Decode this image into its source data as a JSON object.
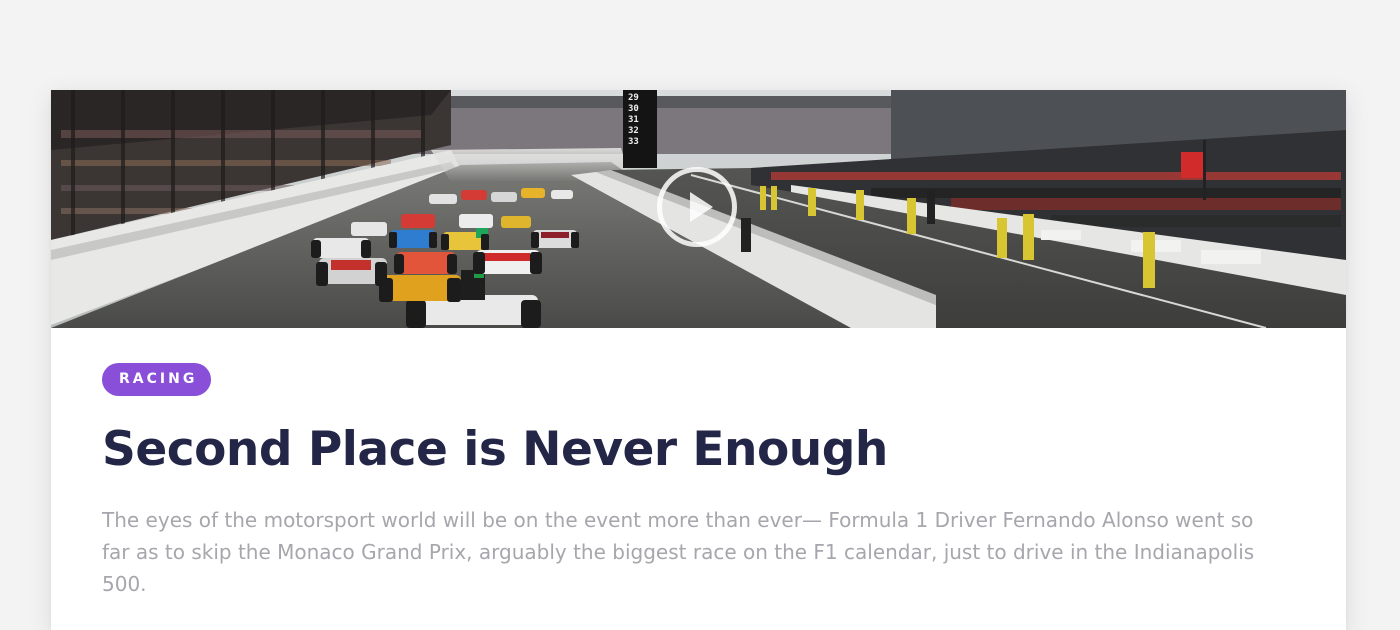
{
  "article": {
    "category": "RACING",
    "title": "Second Place is Never Enough",
    "summary": "The eyes of the motorsport world will be on the event more than ever— Formula 1 Driver Fernando Alonso went so far as to skip the Monaco Grand Prix, arguably the biggest race on the F1 calendar, just to drive in the Indianapolis 500.",
    "media": {
      "type": "video",
      "scoring_pylon": [
        "29",
        "30",
        "31",
        "32",
        "33"
      ]
    }
  },
  "colors": {
    "page_background": "#f3f3f3",
    "card_background": "#ffffff",
    "badge": "#8a4fd8",
    "title": "#232646",
    "summary": "#a6a6ac"
  },
  "icons": {
    "play": "play-icon"
  }
}
